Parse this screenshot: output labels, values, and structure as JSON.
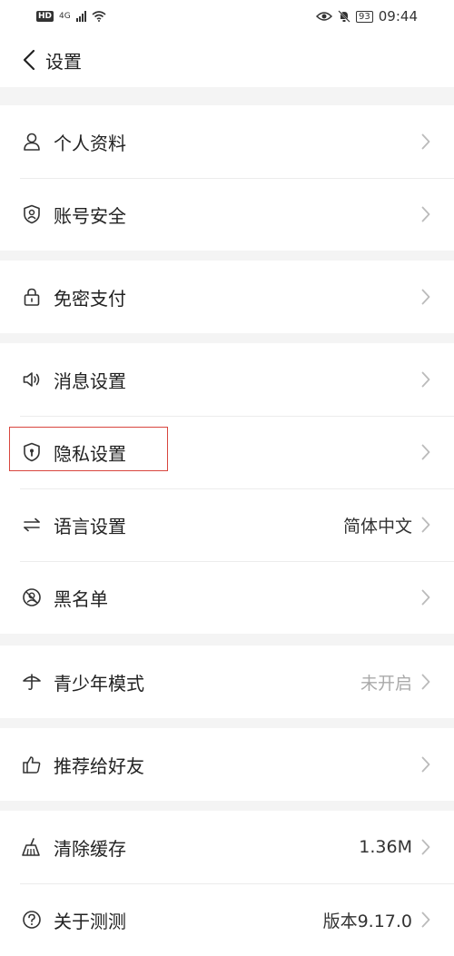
{
  "status_bar": {
    "hd": "HD",
    "network": "4G",
    "battery": "93",
    "time": "09:44"
  },
  "header": {
    "title": "设置"
  },
  "groups": [
    {
      "items": [
        {
          "label": "个人资料",
          "icon": "person-icon"
        },
        {
          "label": "账号安全",
          "icon": "shield-user-icon"
        }
      ]
    },
    {
      "items": [
        {
          "label": "免密支付",
          "icon": "lock-icon"
        }
      ]
    },
    {
      "items": [
        {
          "label": "消息设置",
          "icon": "speaker-icon"
        },
        {
          "label": "隐私设置",
          "icon": "privacy-shield-icon"
        },
        {
          "label": "语言设置",
          "icon": "swap-arrows-icon",
          "value": "简体中文"
        },
        {
          "label": "黑名单",
          "icon": "block-icon"
        }
      ]
    },
    {
      "items": [
        {
          "label": "青少年模式",
          "icon": "umbrella-icon",
          "value": "未开启"
        }
      ]
    },
    {
      "items": [
        {
          "label": "推荐给好友",
          "icon": "thumbs-up-icon"
        }
      ]
    },
    {
      "items": [
        {
          "label": "清除缓存",
          "icon": "broom-icon",
          "value": "1.36M"
        },
        {
          "label": "关于测测",
          "icon": "help-circle-icon",
          "value": "版本9.17.0"
        }
      ]
    }
  ],
  "highlight": {
    "target": "隐私设置",
    "color": "#d8463e"
  }
}
